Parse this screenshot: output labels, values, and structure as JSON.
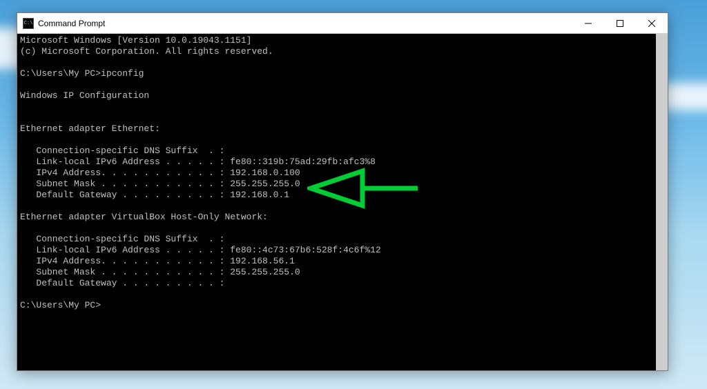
{
  "window": {
    "title": "Command Prompt"
  },
  "terminal": {
    "lines": [
      "Microsoft Windows [Version 10.0.19043.1151]",
      "(c) Microsoft Corporation. All rights reserved.",
      "",
      "C:\\Users\\My PC>ipconfig",
      "",
      "Windows IP Configuration",
      "",
      "",
      "Ethernet adapter Ethernet:",
      "",
      "   Connection-specific DNS Suffix  . :",
      "   Link-local IPv6 Address . . . . . : fe80::319b:75ad:29fb:afc3%8",
      "   IPv4 Address. . . . . . . . . . . : 192.168.0.100",
      "   Subnet Mask . . . . . . . . . . . : 255.255.255.0",
      "   Default Gateway . . . . . . . . . : 192.168.0.1",
      "",
      "Ethernet adapter VirtualBox Host-Only Network:",
      "",
      "   Connection-specific DNS Suffix  . :",
      "   Link-local IPv6 Address . . . . . : fe80::4c73:67b6:528f:4c6f%12",
      "   IPv4 Address. . . . . . . . . . . : 192.168.56.1",
      "   Subnet Mask . . . . . . . . . . . : 255.255.255.0",
      "   Default Gateway . . . . . . . . . :",
      "",
      "C:\\Users\\My PC>"
    ]
  },
  "annotation": {
    "arrow_color": "#00cc33",
    "target": "Default Gateway 192.168.0.1"
  }
}
